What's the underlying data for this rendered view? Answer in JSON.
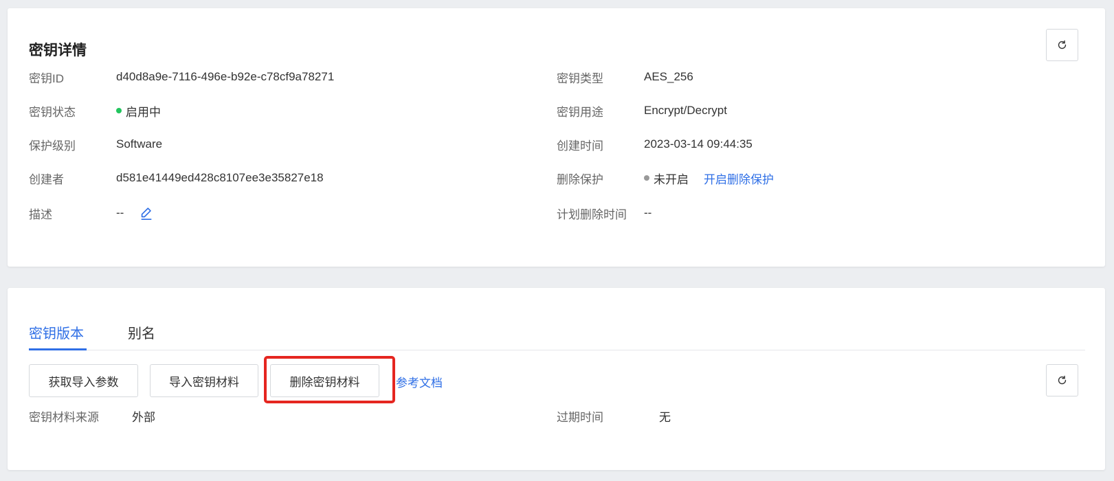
{
  "detail": {
    "title": "密钥详情",
    "left": [
      {
        "label": "密钥ID",
        "value": "d40d8a9e-7116-496e-b92e-c78cf9a78271"
      },
      {
        "label": "密钥状态",
        "value": "启用中"
      },
      {
        "label": "保护级别",
        "value": "Software"
      },
      {
        "label": "创建者",
        "value": "d581e41449ed428c8107ee3e35827e18"
      },
      {
        "label": "描述",
        "value": "--"
      }
    ],
    "right": [
      {
        "label": "密钥类型",
        "value": "AES_256"
      },
      {
        "label": "密钥用途",
        "value": "Encrypt/Decrypt"
      },
      {
        "label": "创建时间",
        "value": "2023-03-14 09:44:35"
      },
      {
        "label": "删除保护",
        "value": "未开启",
        "link": "开启删除保护"
      },
      {
        "label": "计划删除时间",
        "value": "--"
      }
    ],
    "status_color": "#22c55e",
    "protection_color": "#999999"
  },
  "versions": {
    "tabs": [
      {
        "label": "密钥版本",
        "active": true
      },
      {
        "label": "别名",
        "active": false
      }
    ],
    "buttons": {
      "get_import_params": "获取导入参数",
      "import_material": "导入密钥材料",
      "delete_material": "删除密钥材料"
    },
    "doc_link": "参考文档",
    "fields": [
      {
        "label": "密钥材料来源",
        "value": "外部"
      },
      {
        "label": "过期时间",
        "value": "无"
      }
    ]
  },
  "colors": {
    "accent": "#2f6fe6",
    "highlight": "#e52620"
  },
  "icons": [
    "refresh-icon",
    "edit-icon"
  ]
}
